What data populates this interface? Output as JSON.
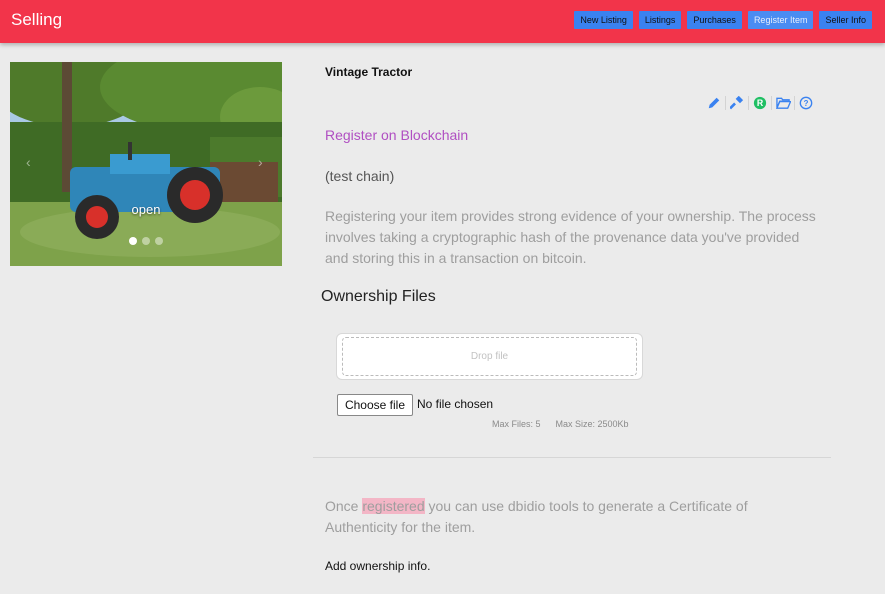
{
  "header": {
    "title": "Selling",
    "nav": [
      {
        "label": "New Listing"
      },
      {
        "label": "Listings"
      },
      {
        "label": "Purchases"
      },
      {
        "label": "Register Item",
        "active": true
      },
      {
        "label": "Seller Info"
      }
    ],
    "bar_color": "#f2344a",
    "button_color": "#3a82f0"
  },
  "carousel": {
    "overlay_label": "open",
    "slide_count": 3,
    "active_slide": 1
  },
  "item": {
    "title": "Vintage Tractor",
    "toolbar_icons": [
      "pencil-icon",
      "gavel-icon",
      "registered-icon",
      "folder-open-icon",
      "question-icon"
    ]
  },
  "register": {
    "link": "Register on Blockchain",
    "link_color": "#b04fc2",
    "chain": "(test chain)",
    "description": "Registering your item provides strong evidence of your ownership. The process involves taking a cryptographic hash of the provenance data you've provided and storing this in a transaction on bitcoin."
  },
  "ownership_files": {
    "heading": "Ownership Files",
    "drop_label": "Drop file",
    "choose_button": "Choose file",
    "file_status": "No file chosen",
    "max_files": "Max Files: 5",
    "max_size": "Max Size: 2500Kb"
  },
  "footer": {
    "once_before": "Once ",
    "once_highlight": "registered",
    "once_after": " you can use dbidio tools to generate a Certificate of Authenticity for the item.",
    "add_info": "Add ownership info."
  }
}
